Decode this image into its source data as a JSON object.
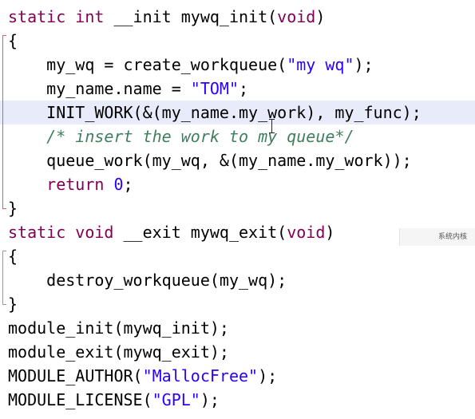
{
  "editor": {
    "lines": [
      {
        "code": "static int __init mywq_init(void)"
      },
      {
        "code": "{"
      },
      {
        "code": "    my_wq = create_workqueue(\"my wq\");"
      },
      {
        "code": "    my_name.name = \"TOM\";"
      },
      {
        "code": "    INIT_WORK(&(my_name.my_work), my_func);"
      },
      {
        "code": "    /* insert the work to my queue*/"
      },
      {
        "code": "    queue_work(my_wq, &(my_name.my_work));"
      },
      {
        "code": "    return 0;"
      },
      {
        "code": "}"
      },
      {
        "code": "static void __exit mywq_exit(void)"
      },
      {
        "code": "{"
      },
      {
        "code": "    destroy_workqueue(my_wq);"
      },
      {
        "code": "}"
      },
      {
        "code": "module_init(mywq_init);"
      },
      {
        "code": "module_exit(mywq_exit);"
      },
      {
        "code": "MODULE_AUTHOR(\"MallocFree\");"
      },
      {
        "code": "MODULE_LICENSE(\"GPL\");"
      }
    ],
    "current_line_index": 4,
    "colors": {
      "keyword": "#7f0055",
      "string": "#2a00ff",
      "number": "#2a00ff",
      "comment": "#3f7f5f",
      "current_line": "#e8ebfa",
      "fold_marker_active": "#ea5a4a",
      "fold_marker_inactive": "#9a9a9a"
    }
  },
  "overlay": {
    "text": "系统内核"
  }
}
